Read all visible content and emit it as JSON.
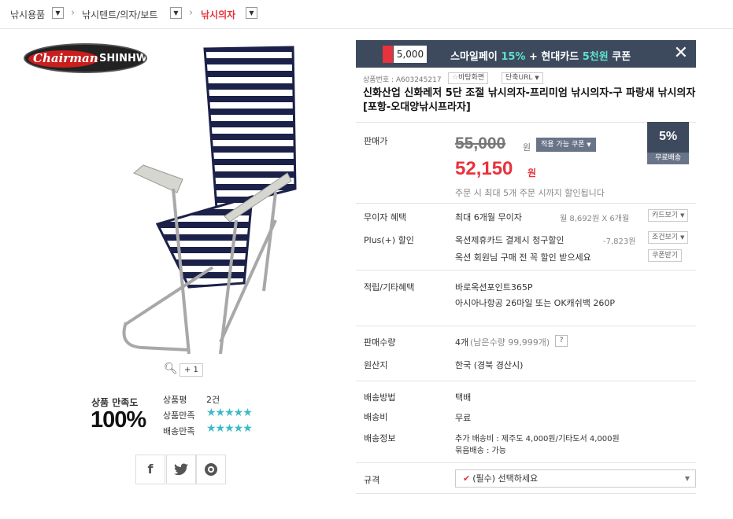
{
  "breadcrumb": {
    "items": [
      "낚시용품",
      "낚시텐트/의자/보트",
      "낚시의자"
    ],
    "dropdown_icon": "chevron-down-icon",
    "active_color": "#e8323c"
  },
  "gallery": {
    "logo_text_1": "Chairman",
    "logo_text_2": "SHINHWA",
    "more_images": "+ 1",
    "zoom_icon": "search-icon"
  },
  "satisfaction": {
    "label": "상품 만족도",
    "percent": "100%",
    "review_label": "상품평",
    "review_count": "2건",
    "product_label": "상품만족",
    "delivery_label": "배송만족",
    "product_rating": 5,
    "delivery_rating": 5,
    "star_color": "#3bbbc8"
  },
  "share": {
    "facebook": "f",
    "twitter_icon": "twitter-icon",
    "kakao_icon": "kakao-icon"
  },
  "banner": {
    "icon_text": "5,000",
    "text_a": "스마일페이 ",
    "text_b": "15%",
    "text_c": " + 현대카드 ",
    "text_d": "5천원",
    "text_e": " 쿠폰",
    "close": "✕",
    "bg_color": "#3d4a5e"
  },
  "product": {
    "number": "상품번호 : A603245217",
    "favorite_label": "바탕화면",
    "short_url_label": "단축URL",
    "title": "신화산업 신화레저 5단 조절 낚시의자-프리미엄 낚시의자-구 파랑새 낚시의자 [포항-오대양낚시프라자]"
  },
  "price": {
    "label": "판매가",
    "original": "55,000",
    "original_unit": "원",
    "coupon_button": "적용 가능 쿠폰",
    "sale": "52,150",
    "sale_unit": "원",
    "note": "주문 시 최대 5개 주문 시까지 할인됩니다",
    "discount": "5%",
    "free_shipping": "무료배송"
  },
  "benefits": {
    "installment_label": "무이자 혜택",
    "installment_value": "최대 6개월 무이자",
    "installment_detail": "월 8,692원 X 6개월",
    "card_view_button": "카드보기",
    "plus_label": "Plus(+) 할인",
    "plus_value": "옥션제휴카드 결제시 청구할인",
    "plus_amount": "-7,823원",
    "condition_button": "조건보기",
    "member_value": "옥션 회원님 구매 전 꼭 할인 받으세요",
    "coupon_download_button": "쿠폰받기"
  },
  "points": {
    "label": "적립/기타혜택",
    "line1": "바로옥션포인트365P",
    "line2": "아시아나항공 26마일 또는 OK캐쉬백 260P"
  },
  "sales": {
    "quantity_label": "판매수량",
    "quantity_value": "4개",
    "remaining": "(남은수량 99,999개)",
    "help": "?",
    "origin_label": "원산지",
    "origin_value": "한국 (경북 경산시)"
  },
  "shipping": {
    "method_label": "배송방법",
    "method_value": "택배",
    "fee_label": "배송비",
    "fee_value": "무료",
    "info_label": "배송정보",
    "info_line1": "추가 배송비 : 제주도 4,000원/기타도서 4,000원",
    "info_line2": "묶음배송 : 가능"
  },
  "option": {
    "label": "규격",
    "placeholder": "(필수) 선택하세요"
  }
}
